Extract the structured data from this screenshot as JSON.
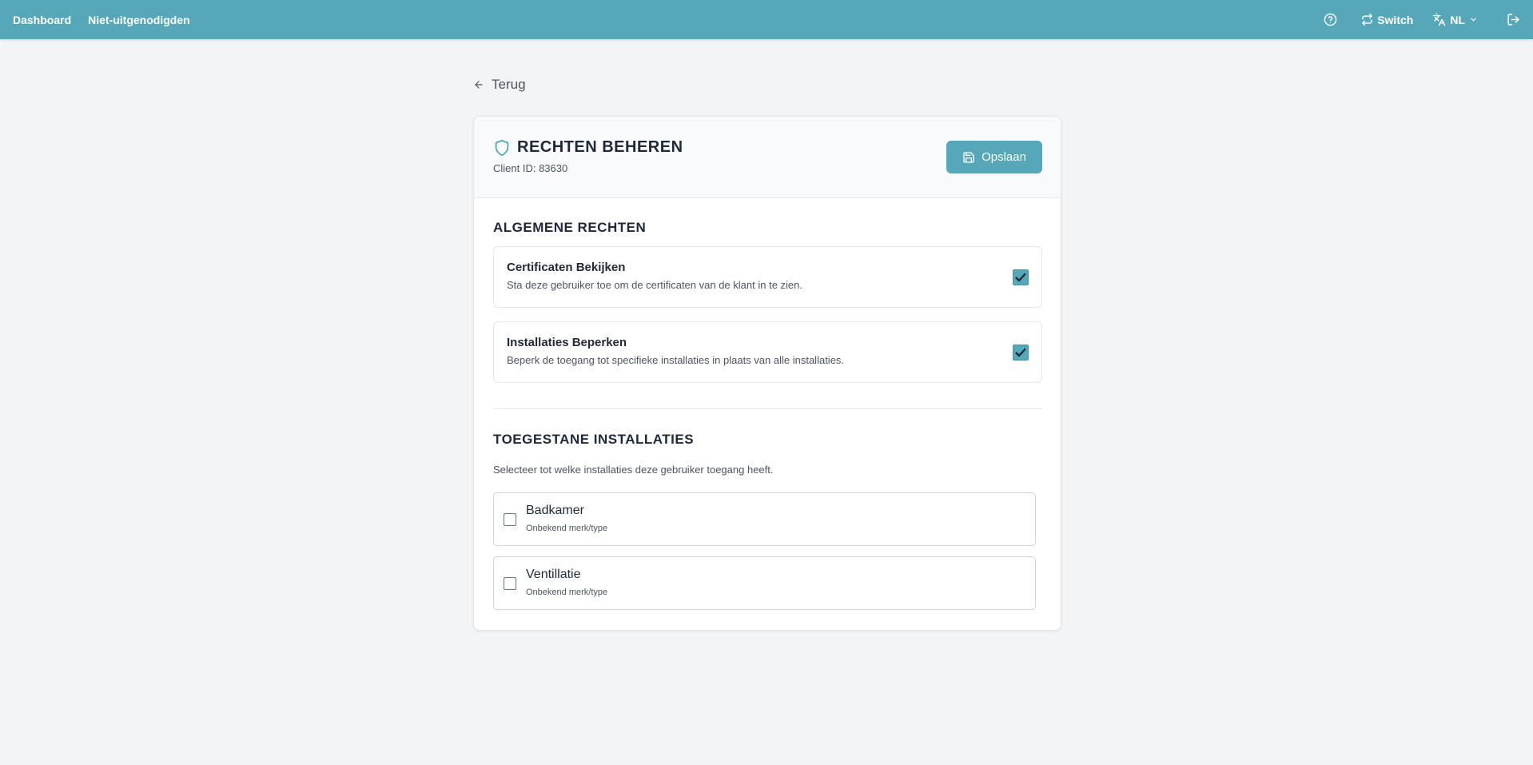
{
  "topbar": {
    "nav": [
      {
        "label": "Dashboard"
      },
      {
        "label": "Niet-uitgenodigden"
      }
    ],
    "switch_label": "Switch",
    "language_label": "NL"
  },
  "back_label": "Terug",
  "card": {
    "title": "RECHTEN BEHEREN",
    "client_id": "Client ID: 83630",
    "save_label": "Opslaan"
  },
  "general": {
    "title": "ALGEMENE RECHTEN",
    "permissions": [
      {
        "title": "Certificaten Bekijken",
        "description": "Sta deze gebruiker toe om de certificaten van de klant in te zien.",
        "checked": true
      },
      {
        "title": "Installaties Beperken",
        "description": "Beperk de toegang tot specifieke installaties in plaats van alle installaties.",
        "checked": true
      }
    ]
  },
  "installations": {
    "title": "TOEGESTANE INSTALLATIES",
    "description": "Selecteer tot welke installaties deze gebruiker toegang heeft.",
    "items": [
      {
        "name": "Badkamer",
        "subtitle": "Onbekend merk/type",
        "checked": false
      },
      {
        "name": "Ventillatie",
        "subtitle": "Onbekend merk/type",
        "checked": false
      }
    ]
  },
  "colors": {
    "accent": "#56a7b7",
    "background": "#f3f4f6"
  },
  "icons": {
    "help": "help-circle-icon",
    "switch": "switch-arrows-icon",
    "language": "translate-icon",
    "logout": "logout-icon",
    "back": "arrow-left-icon",
    "title": "shield-icon",
    "save": "save-icon"
  }
}
